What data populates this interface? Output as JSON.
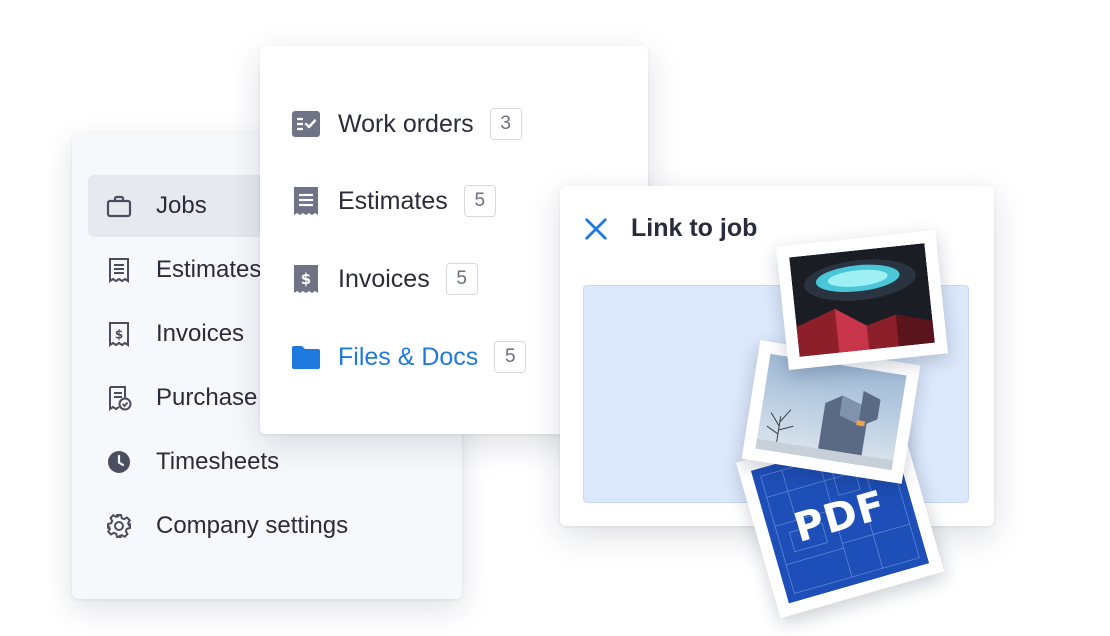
{
  "sidebar": {
    "items": [
      {
        "label": "Jobs",
        "icon": "briefcase-icon",
        "active": true
      },
      {
        "label": "Estimates",
        "icon": "estimate-receipt-icon"
      },
      {
        "label": "Invoices",
        "icon": "invoice-dollar-icon"
      },
      {
        "label": "Purchase orders",
        "icon": "purchase-order-icon"
      },
      {
        "label": "Timesheets",
        "icon": "clock-icon"
      },
      {
        "label": "Company settings",
        "icon": "gear-icon"
      }
    ]
  },
  "nav": {
    "items": [
      {
        "label": "Work orders",
        "count": "3",
        "icon": "checklist-icon"
      },
      {
        "label": "Estimates",
        "count": "5",
        "icon": "estimate-receipt-icon"
      },
      {
        "label": "Invoices",
        "count": "5",
        "icon": "invoice-dollar-icon"
      },
      {
        "label": "Files & Docs",
        "count": "5",
        "icon": "folder-icon",
        "active": true
      }
    ]
  },
  "link_card": {
    "title": "Link to job",
    "close_icon": "close-icon"
  },
  "photos": {
    "pdf_label": "PDF"
  },
  "colors": {
    "accent": "#1f7ae0",
    "icon_gray": "#5f6374",
    "dropzone": "#dce8fb",
    "blueprint": "#1e4fb8"
  }
}
